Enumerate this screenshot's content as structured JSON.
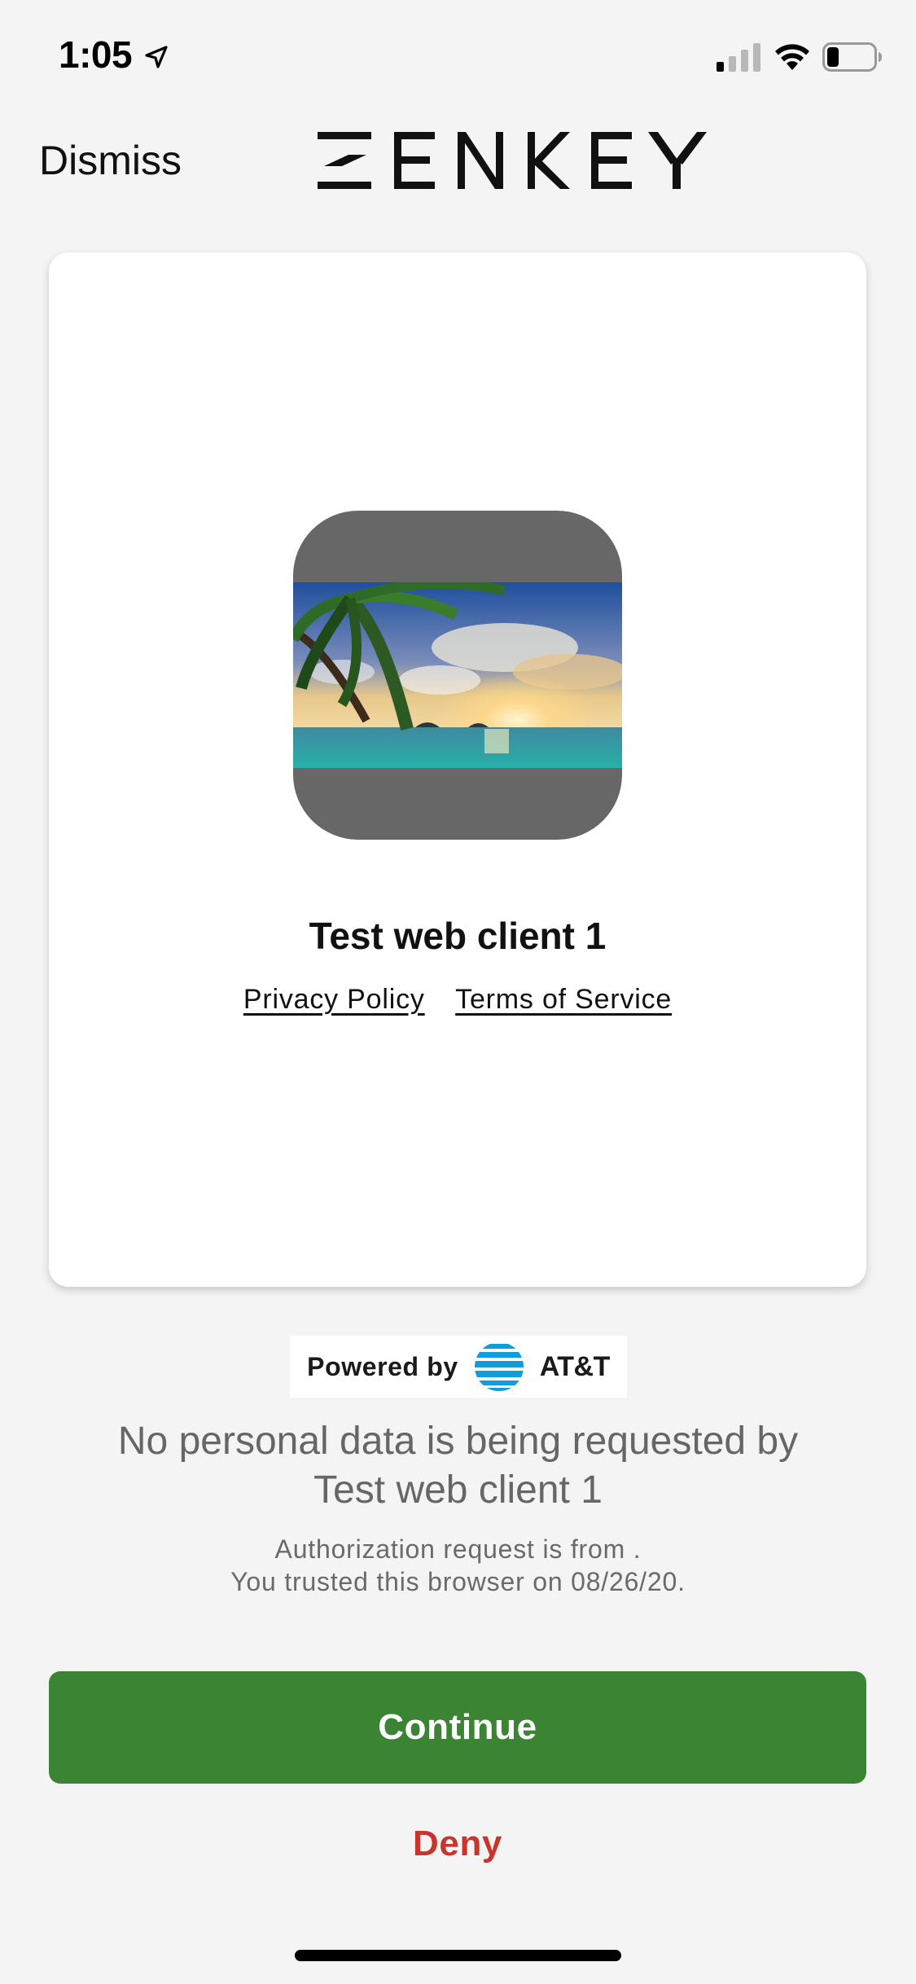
{
  "status_bar": {
    "time": "1:05",
    "location_icon": "location-arrow-icon",
    "signal_icon": "cellular-signal-icon",
    "wifi_icon": "wifi-icon",
    "battery_icon": "battery-icon",
    "battery_level": 0.25
  },
  "header": {
    "dismiss_label": "Dismiss",
    "brand": "ZENKEY"
  },
  "card": {
    "client_logo": "client-logo-image",
    "client_name": "Test web client 1",
    "privacy_policy_label": "Privacy Policy",
    "terms_label": "Terms of Service"
  },
  "powered_by": {
    "label": "Powered by",
    "carrier": "AT&T",
    "carrier_icon": "att-globe-icon"
  },
  "message": {
    "line1": "No personal data is being requested by",
    "line2": "Test web client 1",
    "auth_line1": "Authorization request is from .",
    "auth_line2": "You trusted this browser on 08/26/20."
  },
  "actions": {
    "continue_label": "Continue",
    "deny_label": "Deny"
  },
  "colors": {
    "background": "#f4f4f4",
    "continue_button": "#3a8434",
    "deny_text": "#c9342c",
    "client_logo_bg": "#676767"
  }
}
